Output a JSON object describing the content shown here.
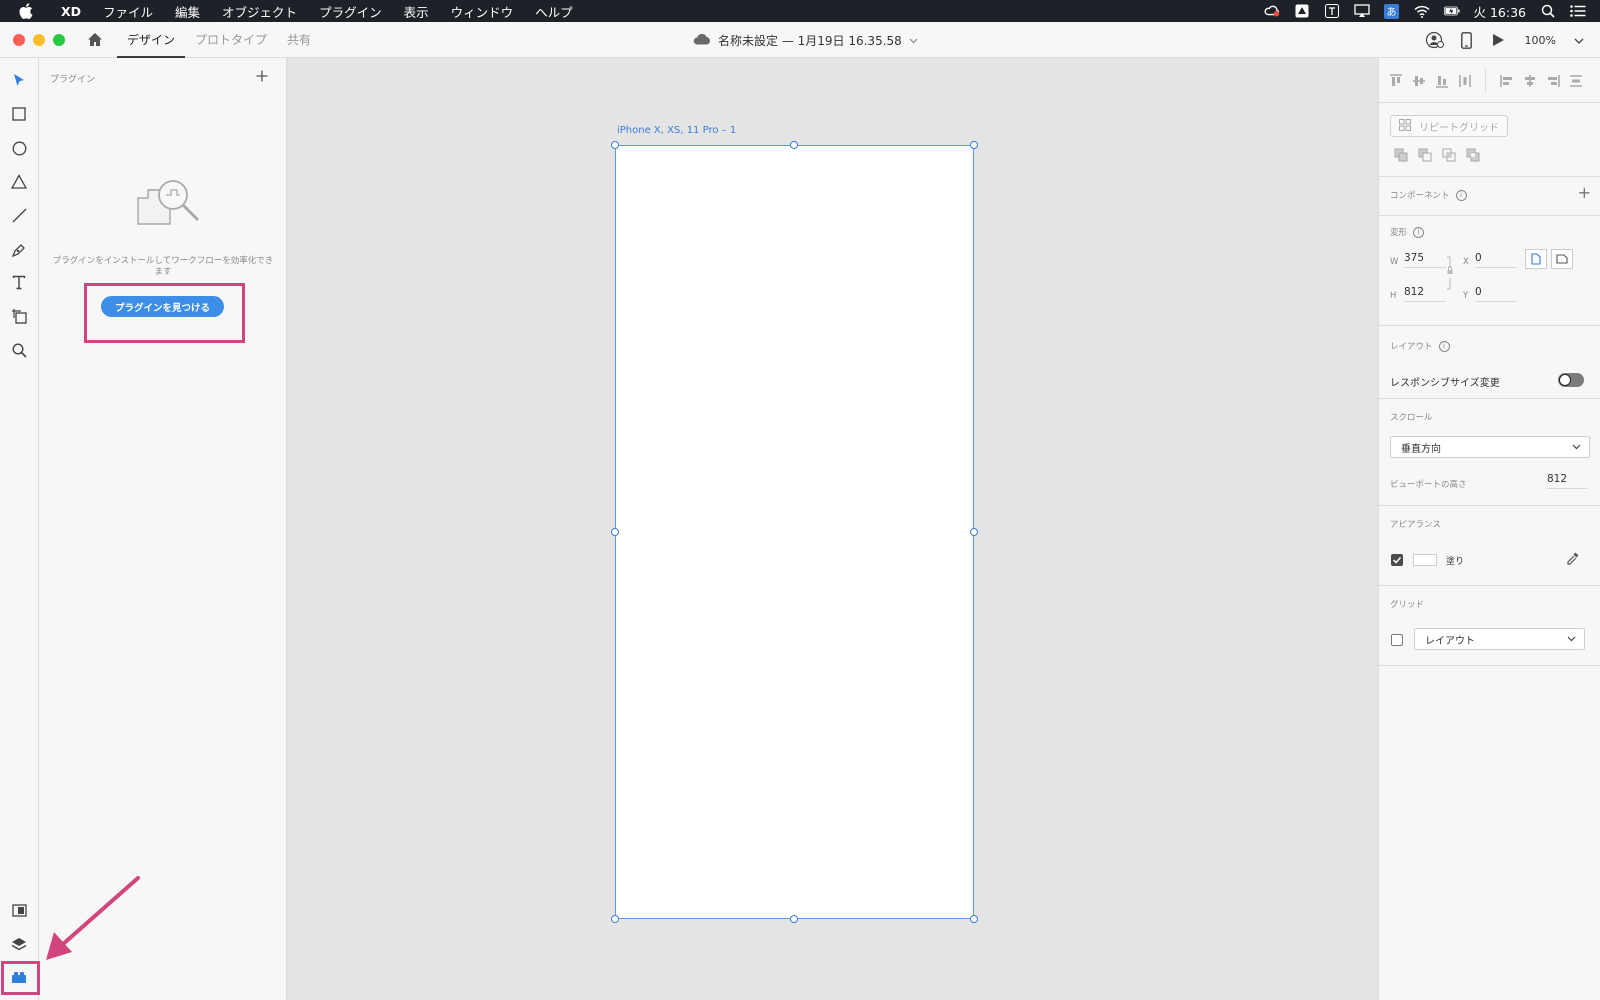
{
  "menubar": {
    "items": [
      "XD",
      "ファイル",
      "編集",
      "オブジェクト",
      "プラグイン",
      "表示",
      "ウィンドウ",
      "ヘルプ"
    ],
    "clock": "火 16:36",
    "ime": "あ"
  },
  "titlebar": {
    "tabs": [
      "デザイン",
      "プロトタイプ",
      "共有"
    ],
    "active_tab": "デザイン",
    "doc_title": "名称未設定 — 1月19日 16.35.58",
    "zoom": "100%"
  },
  "plugin_panel": {
    "header": "プラグイン",
    "description": "プラグインをインストールしてワークフローを効率化できます",
    "find_button": "プラグインを見つける"
  },
  "canvas": {
    "artboard_label": "iPhone X, XS, 11 Pro – 1"
  },
  "right_panel": {
    "repeat_grid": "リピートグリッド",
    "component_title": "コンポーネント",
    "transform_title": "変形",
    "w_label": "W",
    "w_value": "375",
    "h_label": "H",
    "h_value": "812",
    "x_label": "X",
    "x_value": "0",
    "y_label": "Y",
    "y_value": "0",
    "layout_title": "レイアウト",
    "responsive_label": "レスポンシブサイズ変更",
    "responsive_on": false,
    "scroll_title": "スクロール",
    "scroll_value": "垂直方向",
    "viewport_label": "ビューポートの高さ",
    "viewport_value": "812",
    "appearance_title": "アピアランス",
    "fill_label": "塗り",
    "fill_checked": true,
    "fill_color": "#ffffff",
    "grid_title": "グリッド",
    "grid_value": "レイアウト",
    "grid_checked": false
  },
  "colors": {
    "accent": "#3d8ee6",
    "highlight": "#d2467f",
    "selection": "#3d7bd6"
  }
}
